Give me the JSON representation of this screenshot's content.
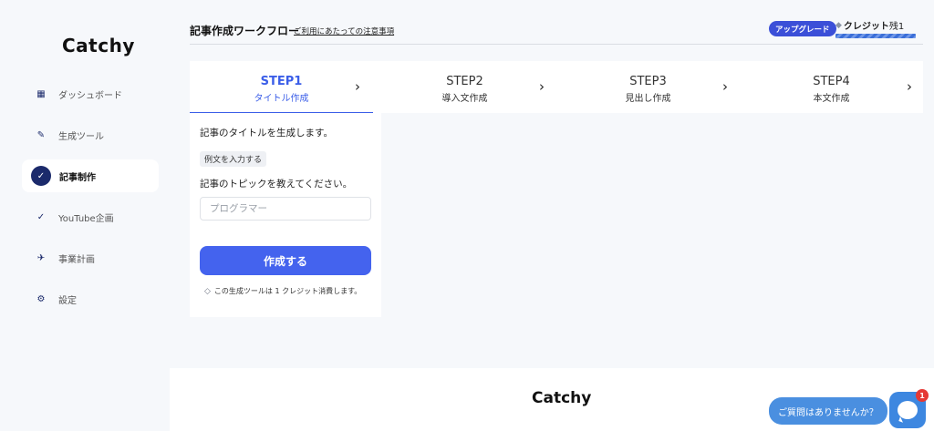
{
  "app": {
    "logo": "Catchy"
  },
  "sidebar": {
    "items": [
      {
        "label": "ダッシュボード",
        "icon": "dashboard-icon",
        "glyph": "▦"
      },
      {
        "label": "生成ツール",
        "icon": "wrench-icon",
        "glyph": "✎"
      },
      {
        "label": "記事制作",
        "icon": "blog-icon",
        "glyph": "✓",
        "active": true
      },
      {
        "label": "YouTube企画",
        "icon": "youtube-icon",
        "glyph": "✓"
      },
      {
        "label": "事業計画",
        "icon": "rocket-icon",
        "glyph": "✈"
      },
      {
        "label": "設定",
        "icon": "gear-icon",
        "glyph": "⚙"
      }
    ]
  },
  "header": {
    "title": "記事作成ワークフロー",
    "notice_link": "ご利用にあたっての注意事項",
    "upgrade_label": "アップグレード",
    "credit_label": "クレジット",
    "credit_remaining": "残1"
  },
  "steps": [
    {
      "num": "STEP1",
      "label": "タイトル作成",
      "active": true
    },
    {
      "num": "STEP2",
      "label": "導入文作成"
    },
    {
      "num": "STEP3",
      "label": "見出し作成"
    },
    {
      "num": "STEP4",
      "label": "本文作成"
    }
  ],
  "form": {
    "description": "記事のタイトルを生成します。",
    "example_button": "例文を入力する",
    "topic_label": "記事のトピックを教えてください。",
    "topic_placeholder": "プログラマー",
    "topic_value": "",
    "submit_label": "作成する",
    "cost_note": "この生成ツールは 1 クレジット消費します。"
  },
  "footer": {
    "logo": "Catchy"
  },
  "chat": {
    "prompt": "ご質問はありませんか？",
    "badge_count": "1"
  },
  "colors": {
    "accent": "#4463ee",
    "navy": "#1b2a6b",
    "chat": "#3d87e0"
  }
}
